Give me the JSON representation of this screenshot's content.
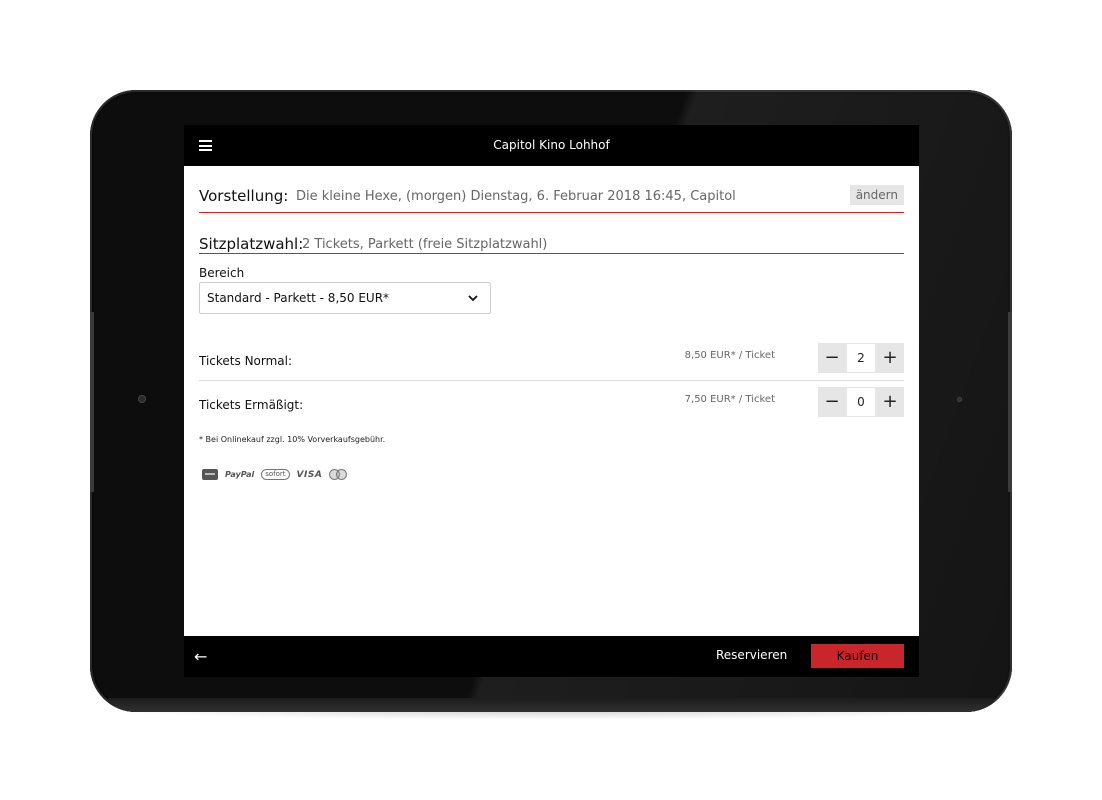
{
  "app": {
    "title": "Capitol Kino Lohhof"
  },
  "icons": {
    "menu": "hamburger-menu-icon",
    "dropdown": "chevron-down-icon",
    "back": "arrow-left-icon"
  },
  "colors": {
    "accent": "#c8262b",
    "bar_background": "#000000",
    "button_gray": "#e6e6e6"
  },
  "vorstellung": {
    "label": "Vorstellung:",
    "value": "Die kleine Hexe, (morgen) Dienstag, 6. Februar 2018 16:45, Capitol",
    "change_label": "ändern"
  },
  "sitzplatz": {
    "label": "Sitzplatzwahl:",
    "value": "2 Tickets, Parkett (freie Sitzplatzwahl)"
  },
  "bereich": {
    "label": "Bereich",
    "selected": "Standard - Parkett - 8,50 EUR*"
  },
  "tickets": [
    {
      "label": "Tickets Normal:",
      "price": "8,50 EUR* / Ticket",
      "quantity": "2"
    },
    {
      "label": "Tickets Ermäßigt:",
      "price": "7,50 EUR* / Ticket",
      "quantity": "0"
    }
  ],
  "stepper": {
    "minus": "−",
    "plus": "+"
  },
  "footnote": "* Bei Onlinekauf zzgl. 10% Vorverkaufsgebühr.",
  "payment": {
    "paypal": "PayPal",
    "sofort": "sofort",
    "visa": "VISA"
  },
  "footer": {
    "back": "←",
    "reserve": "Reservieren",
    "buy": "Kaufen"
  }
}
